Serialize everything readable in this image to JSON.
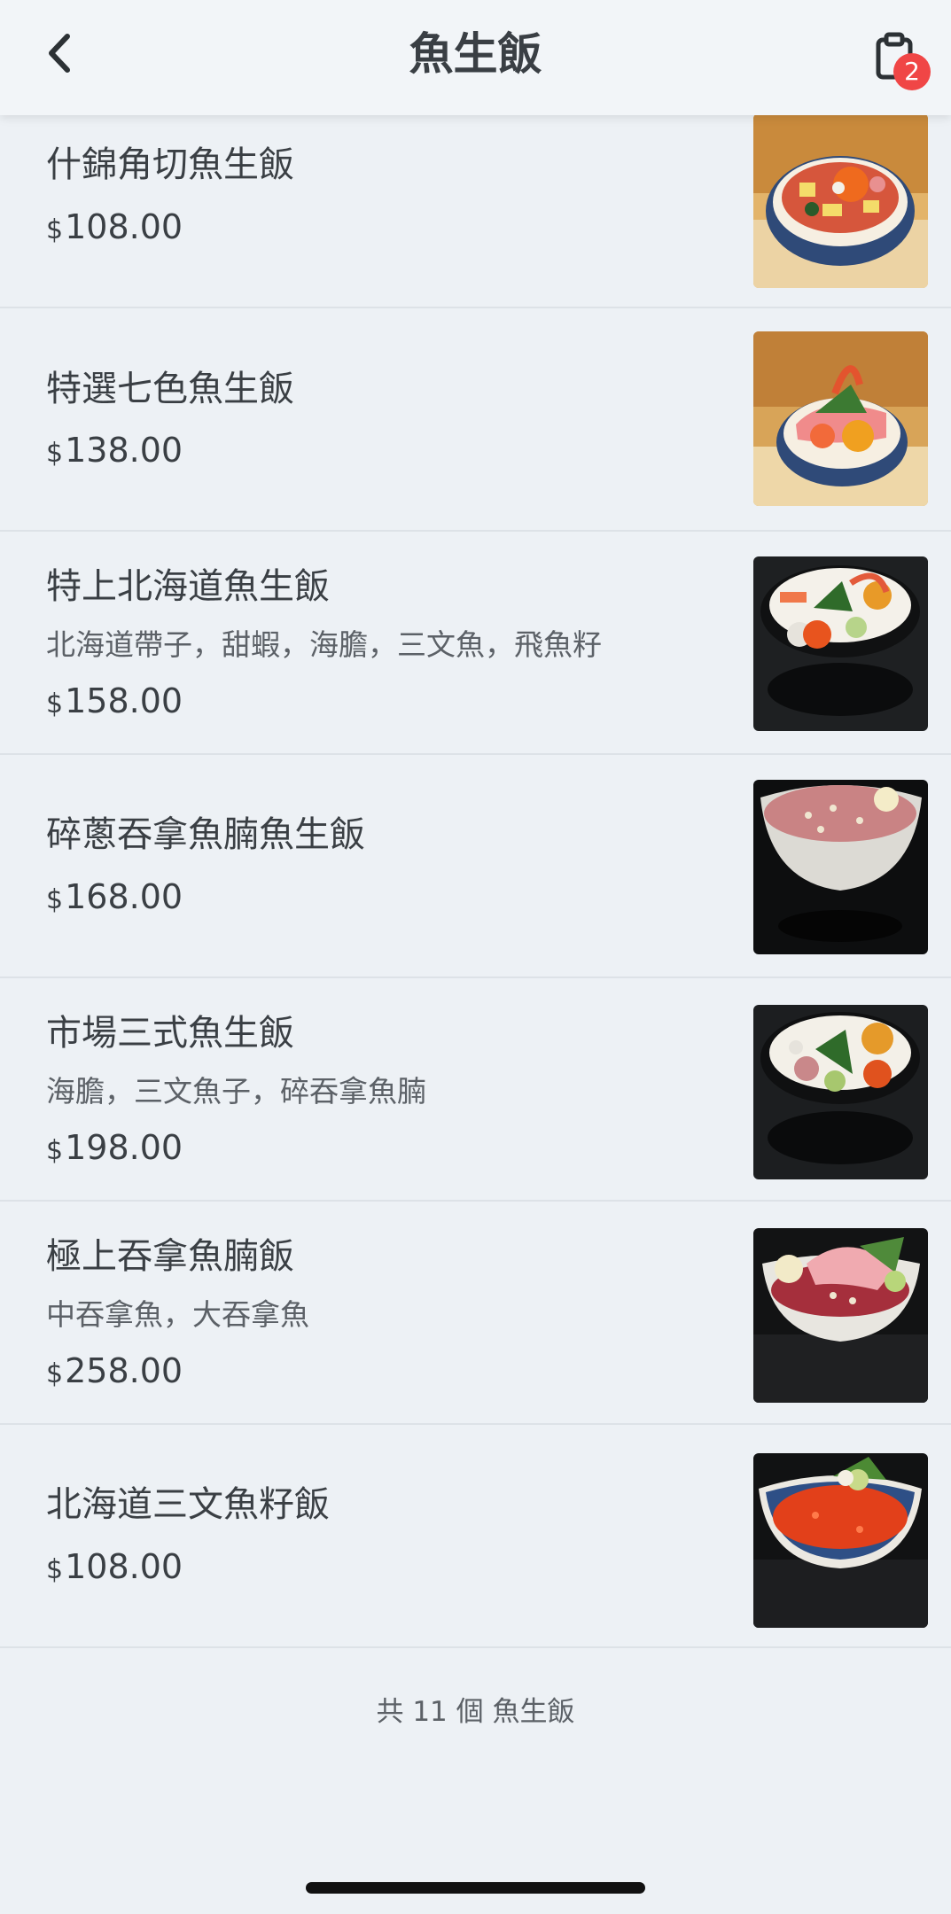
{
  "header": {
    "title": "魚生飯",
    "cart_count": "2"
  },
  "items": [
    {
      "name": "什錦角切魚生飯",
      "desc": "",
      "currency": "$",
      "price": "108.00"
    },
    {
      "name": "特選七色魚生飯",
      "desc": "",
      "currency": "$",
      "price": "138.00"
    },
    {
      "name": "特上北海道魚生飯",
      "desc": "北海道帶子，甜蝦，海膽，三文魚，飛魚籽",
      "currency": "$",
      "price": "158.00"
    },
    {
      "name": "碎蔥吞拿魚腩魚生飯",
      "desc": "",
      "currency": "$",
      "price": "168.00"
    },
    {
      "name": "市場三式魚生飯",
      "desc": "海膽，三文魚子，碎吞拿魚腩",
      "currency": "$",
      "price": "198.00"
    },
    {
      "name": "極上吞拿魚腩飯",
      "desc": "中吞拿魚，大吞拿魚",
      "currency": "$",
      "price": "258.00"
    },
    {
      "name": "北海道三文魚籽飯",
      "desc": "",
      "currency": "$",
      "price": "108.00"
    }
  ],
  "footer": {
    "count_text": "共 11 個 魚生飯"
  },
  "colors": {
    "background": "#edf1f5",
    "badge": "#f04646",
    "text": "#3a3f44"
  }
}
